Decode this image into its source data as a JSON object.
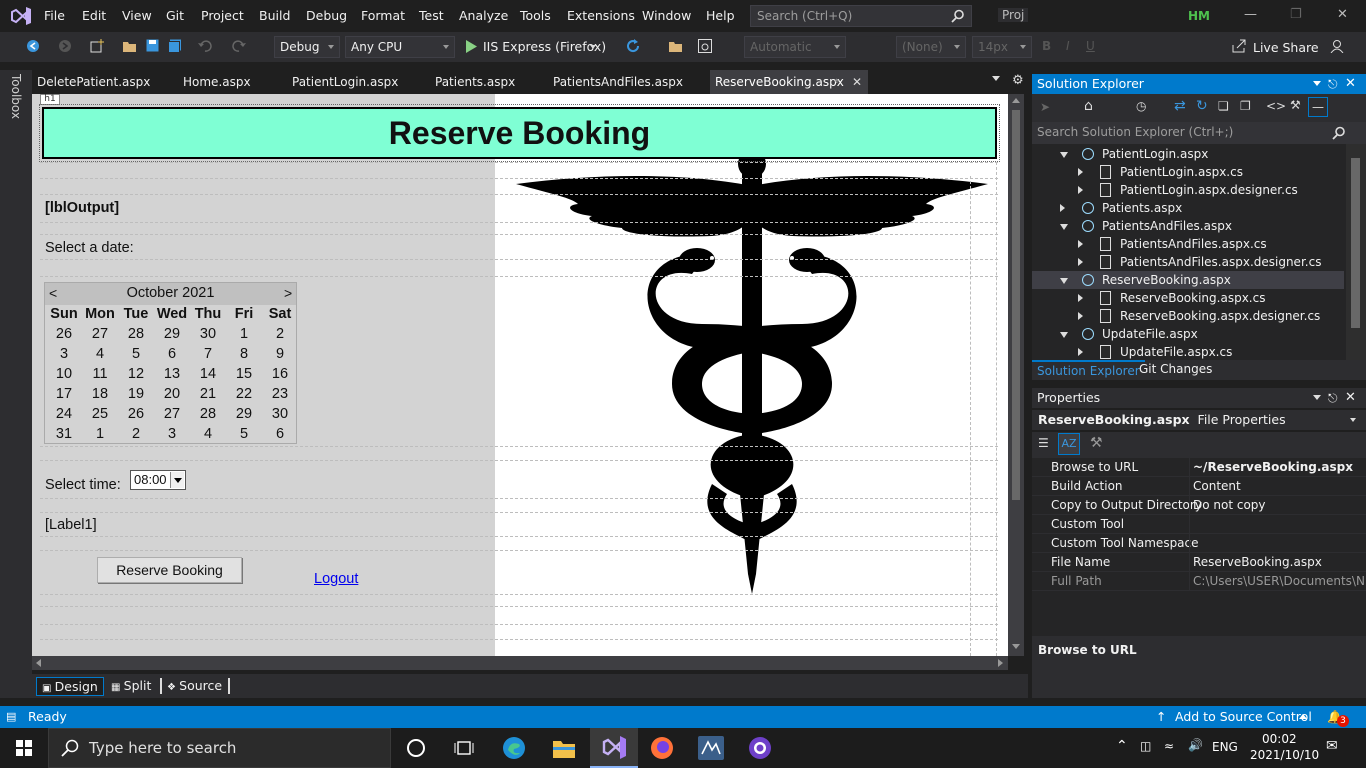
{
  "menu": {
    "items": [
      "File",
      "Edit",
      "View",
      "Git",
      "Project",
      "Build",
      "Debug",
      "Format",
      "Test",
      "Analyze",
      "Tools",
      "Extensions",
      "Window",
      "Help"
    ],
    "search_placeholder": "Search (Ctrl+Q)",
    "project_label": "Proj",
    "user_initials": "HM"
  },
  "toolbar": {
    "config": "Debug",
    "platform": "Any CPU",
    "run_target": "IIS Express (Firefox)",
    "target_schema": "Automatic",
    "style": "(None)",
    "font_size": "14px",
    "live_share": "Live Share"
  },
  "side_strip": {
    "label": "Toolbox"
  },
  "tabs": [
    {
      "label": "DeletePatient.aspx"
    },
    {
      "label": "Home.aspx"
    },
    {
      "label": "PatientLogin.aspx"
    },
    {
      "label": "Patients.aspx"
    },
    {
      "label": "PatientsAndFiles.aspx"
    },
    {
      "label": "ReserveBooking.aspx",
      "active": true
    }
  ],
  "designer": {
    "h1_tag": "h1",
    "banner_title": "Reserve Booking",
    "output_label": "[lblOutput]",
    "select_date_label": "Select a date:",
    "calendar": {
      "prev": "<",
      "next": ">",
      "month": "October 2021",
      "weekdays": [
        "Sun",
        "Mon",
        "Tue",
        "Wed",
        "Thu",
        "Fri",
        "Sat"
      ],
      "weeks": [
        [
          "26",
          "27",
          "28",
          "29",
          "30",
          "1",
          "2"
        ],
        [
          "3",
          "4",
          "5",
          "6",
          "7",
          "8",
          "9"
        ],
        [
          "10",
          "11",
          "12",
          "13",
          "14",
          "15",
          "16"
        ],
        [
          "17",
          "18",
          "19",
          "20",
          "21",
          "22",
          "23"
        ],
        [
          "24",
          "25",
          "26",
          "27",
          "28",
          "29",
          "30"
        ],
        [
          "31",
          "1",
          "2",
          "3",
          "4",
          "5",
          "6"
        ]
      ]
    },
    "select_time_label": "Select time:",
    "time_value": "08:00",
    "label1": "[Label1]",
    "reserve_button": "Reserve Booking",
    "logout_link": "Logout"
  },
  "view_tabs": {
    "design": "Design",
    "split": "Split",
    "source": "Source"
  },
  "solution_explorer": {
    "title": "Solution Explorer",
    "search_placeholder": "Search Solution Explorer (Ctrl+;)",
    "items": [
      {
        "label": "PatientLogin.aspx",
        "level": 1,
        "expanded": true,
        "kind": "web"
      },
      {
        "label": "PatientLogin.aspx.cs",
        "level": 2,
        "kind": "file"
      },
      {
        "label": "PatientLogin.aspx.designer.cs",
        "level": 2,
        "kind": "file"
      },
      {
        "label": "Patients.aspx",
        "level": 1,
        "expanded": false,
        "kind": "web"
      },
      {
        "label": "PatientsAndFiles.aspx",
        "level": 1,
        "expanded": true,
        "kind": "web"
      },
      {
        "label": "PatientsAndFiles.aspx.cs",
        "level": 2,
        "kind": "file"
      },
      {
        "label": "PatientsAndFiles.aspx.designer.cs",
        "level": 2,
        "kind": "file"
      },
      {
        "label": "ReserveBooking.aspx",
        "level": 1,
        "expanded": true,
        "kind": "web",
        "selected": true
      },
      {
        "label": "ReserveBooking.aspx.cs",
        "level": 2,
        "kind": "file"
      },
      {
        "label": "ReserveBooking.aspx.designer.cs",
        "level": 2,
        "kind": "file"
      },
      {
        "label": "UpdateFile.aspx",
        "level": 1,
        "expanded": true,
        "kind": "web"
      },
      {
        "label": "UpdateFile.aspx.cs",
        "level": 2,
        "kind": "file"
      }
    ],
    "tabs": [
      "Solution Explorer",
      "Git Changes"
    ]
  },
  "properties": {
    "title": "Properties",
    "object_name": "ReserveBooking.aspx",
    "object_type": "File Properties",
    "rows": [
      {
        "name": "Browse to URL",
        "value": "~/ReserveBooking.aspx",
        "bold": true
      },
      {
        "name": "Build Action",
        "value": "Content"
      },
      {
        "name": "Copy to Output Directory",
        "value": "Do not copy"
      },
      {
        "name": "Custom Tool",
        "value": ""
      },
      {
        "name": "Custom Tool Namespace",
        "value": ""
      },
      {
        "name": "File Name",
        "value": "ReserveBooking.aspx"
      },
      {
        "name": "Full Path",
        "value": "C:\\Users\\USER\\Documents\\NW",
        "dim": true
      }
    ],
    "description": "Browse to URL"
  },
  "statusbar": {
    "status": "Ready",
    "source_control": "Add to Source Control",
    "notifications": "3"
  },
  "taskbar": {
    "search_placeholder": "Type here to search",
    "language": "ENG",
    "time": "00:02",
    "date": "2021/10/10"
  },
  "colors": {
    "accent": "#007acc",
    "banner": "#7fffd4",
    "link": "#0000ee"
  }
}
